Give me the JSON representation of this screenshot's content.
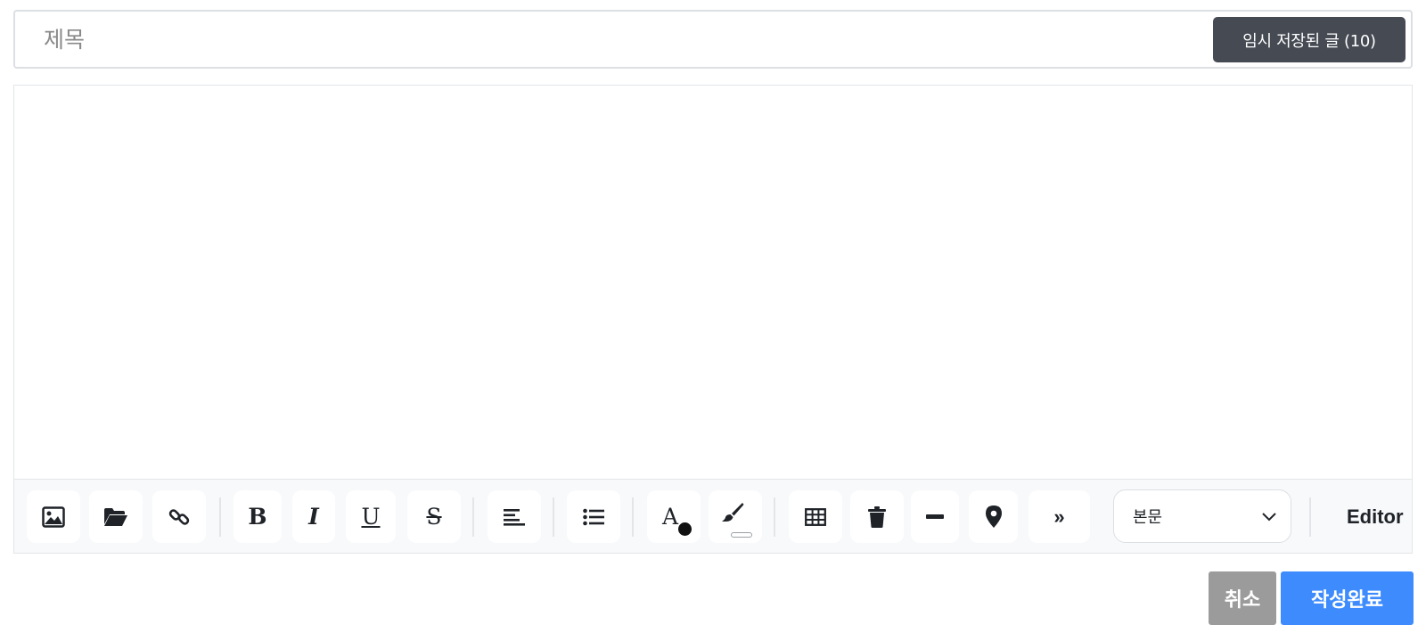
{
  "title": {
    "placeholder": "제목",
    "value": "",
    "temp_saved_label": "임시 저장된 글 (10)"
  },
  "editor": {
    "content": ""
  },
  "toolbar": {
    "icons": [
      "image-icon",
      "folder-open-icon",
      "link-icon",
      "bold-icon",
      "italic-icon",
      "underline-icon",
      "strikethrough-icon",
      "align-left-icon",
      "list-icon",
      "font-color-icon",
      "highlight-brush-icon",
      "table-icon",
      "trash-icon",
      "horizontal-rule-icon",
      "map-pin-icon",
      "more-icon"
    ],
    "glyphs": {
      "bold": "B",
      "italic": "I",
      "underline": "U",
      "strike": "S",
      "font_color": "A",
      "more": "»"
    },
    "font_color_value": "#111111",
    "highlight_color_value": "#ffffff",
    "style_select": {
      "selected": "본문"
    },
    "mode_label": "Editor"
  },
  "actions": {
    "cancel_label": "취소",
    "submit_label": "작성완료"
  },
  "colors": {
    "temp_saved_bg": "#454a53",
    "cancel_bg": "#9b9b9b",
    "submit_bg": "#3d8bfd"
  }
}
